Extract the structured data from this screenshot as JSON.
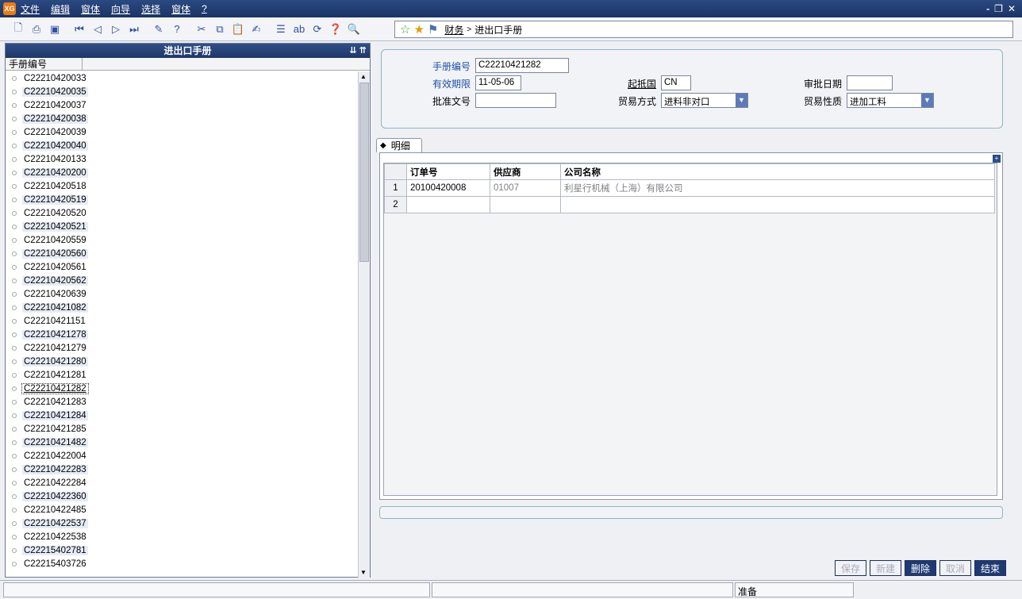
{
  "menu": {
    "logo_text": "XG",
    "items": [
      "文件",
      "编辑",
      "窗体",
      "向导",
      "选择",
      "窗体",
      "?"
    ],
    "win_controls": [
      "-",
      "❐",
      "✕"
    ]
  },
  "breadcrumb": {
    "link": "财务",
    "sep": ">",
    "current": "进出口手册"
  },
  "left_panel": {
    "title": "进出口手册",
    "column_header": "手册编号",
    "selected_index": 23,
    "items": [
      "C22210420033",
      "C22210420035",
      "C22210420037",
      "C22210420038",
      "C22210420039",
      "C22210420040",
      "C22210420133",
      "C22210420200",
      "C22210420518",
      "C22210420519",
      "C22210420520",
      "C22210420521",
      "C22210420559",
      "C22210420560",
      "C22210420561",
      "C22210420562",
      "C22210420639",
      "C22210421082",
      "C22210421151",
      "C22210421278",
      "C22210421279",
      "C22210421280",
      "C22210421281",
      "C22210421282",
      "C22210421283",
      "C22210421284",
      "C22210421285",
      "C22210421482",
      "C22210422004",
      "C22210422283",
      "C22210422284",
      "C22210422360",
      "C22210422485",
      "C22210422537",
      "C22210422538",
      "C22215402781",
      "C22215403726"
    ]
  },
  "form": {
    "handbook_no_label": "手册编号",
    "handbook_no": "C22210421282",
    "valid_until_label": "有效期限",
    "valid_until": "11-05-06",
    "origin_label": "起抵国",
    "origin": "CN",
    "approve_date_label": "审批日期",
    "approve_date": "",
    "approval_doc_label": "批准文号",
    "approval_doc": "",
    "trade_mode_label": "贸易方式",
    "trade_mode": "进料非对口",
    "trade_nature_label": "贸易性质",
    "trade_nature": "进加工料"
  },
  "detail_tab": {
    "label": "明细"
  },
  "grid": {
    "headers": [
      "订单号",
      "供应商",
      "公司名称"
    ],
    "rows": [
      {
        "n": "1",
        "order": "20100420008",
        "supplier": "01007",
        "company": "利星行机械（上海）有限公司"
      },
      {
        "n": "2",
        "order": "",
        "supplier": "",
        "company": ""
      }
    ]
  },
  "buttons": {
    "save": "保存",
    "new": "新建",
    "delete": "删除",
    "cancel": "取消",
    "finish": "结束"
  },
  "status": {
    "ready": "准备"
  }
}
